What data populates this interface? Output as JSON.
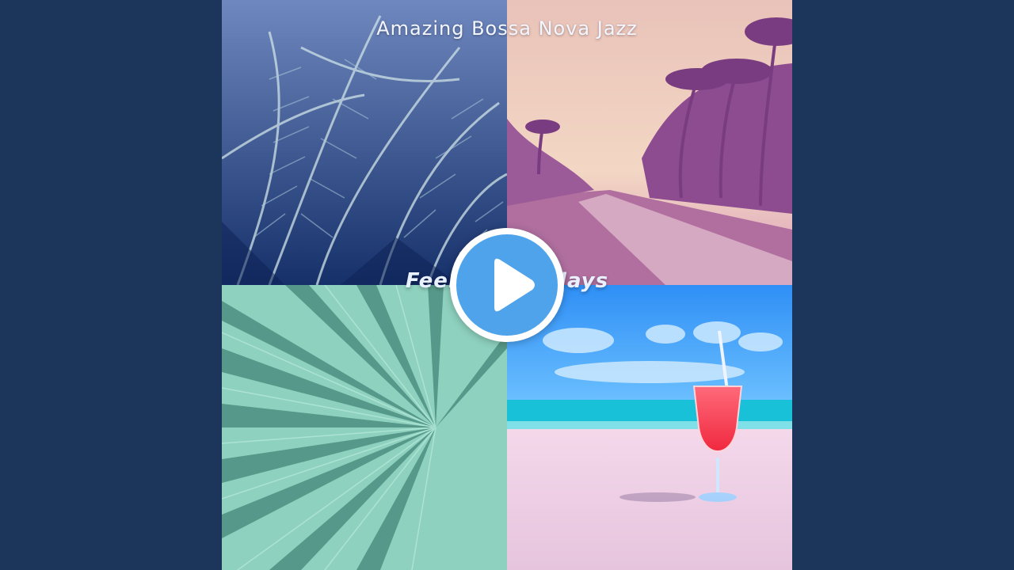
{
  "video": {
    "artist_title": "Amazing Bossa Nova Jazz",
    "album_title": "Feeling Holidays",
    "play_icon": "play-icon"
  },
  "colors": {
    "background": "#1b365a",
    "play_button": "#4fa3ea"
  }
}
